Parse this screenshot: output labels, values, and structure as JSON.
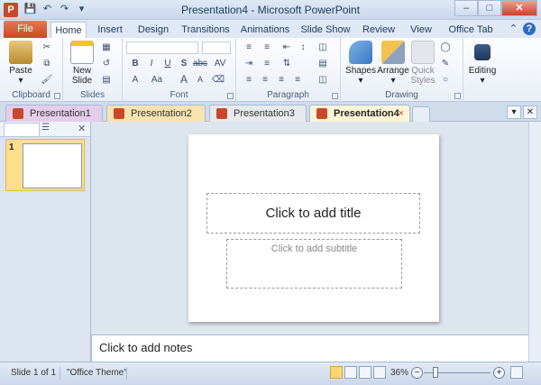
{
  "window": {
    "title": "Presentation4 - Microsoft PowerPoint",
    "app_icon": "P"
  },
  "ribbon_tabs": {
    "file": "File",
    "home": "Home",
    "insert": "Insert",
    "design": "Design",
    "transitions": "Transitions",
    "animations": "Animations",
    "slide_show": "Slide Show",
    "review": "Review",
    "view": "View",
    "office_tab": "Office Tab"
  },
  "groups": {
    "clipboard": {
      "label": "Clipboard",
      "paste": "Paste"
    },
    "slides": {
      "label": "Slides",
      "new_slide_line1": "New",
      "new_slide_line2": "Slide"
    },
    "font": {
      "label": "Font",
      "bold": "B",
      "italic": "I",
      "underline": "U",
      "shadow": "S",
      "strike": "abc",
      "spacing": "AV",
      "size_up": "A",
      "size_down": "A",
      "case": "Aa",
      "clear": "A"
    },
    "paragraph": {
      "label": "Paragraph"
    },
    "drawing": {
      "label": "Drawing",
      "shapes": "Shapes",
      "arrange": "Arrange",
      "quick_line1": "Quick",
      "quick_line2": "Styles"
    },
    "editing": {
      "label": "Editing"
    }
  },
  "doc_tabs": {
    "t1": "Presentation1",
    "t2": "Presentation2",
    "t3": "Presentation3",
    "t4": "Presentation4",
    "close": "×"
  },
  "slide_pane": {
    "thumb_number": "1"
  },
  "slide": {
    "title_placeholder": "Click to add title",
    "subtitle_placeholder": "Click to add subtitle"
  },
  "notes": {
    "placeholder": "Click to add notes"
  },
  "status": {
    "slide_info": "Slide 1 of 1",
    "theme": "\"Office Theme\"",
    "zoom": "36%"
  },
  "colors": {
    "file_tab": "#c44a24",
    "active_doc_tab": "#fdf5d8",
    "powerpoint_accent": "#c8492a"
  }
}
